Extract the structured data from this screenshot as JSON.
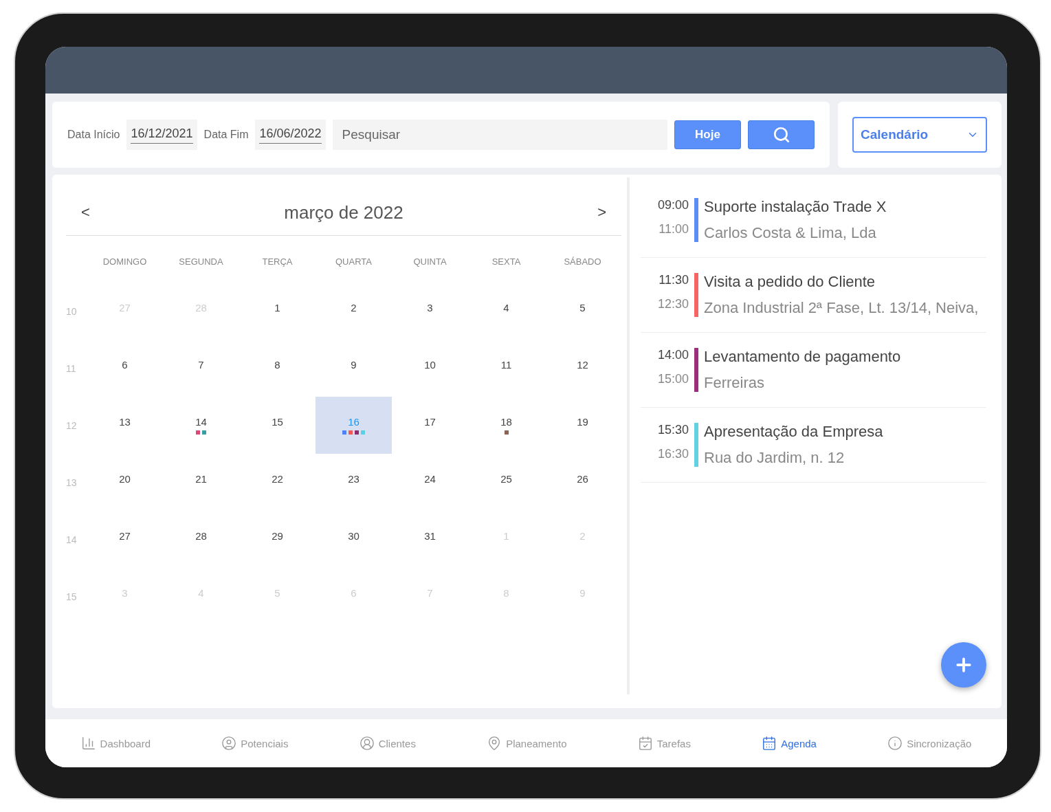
{
  "filters": {
    "start_label": "Data Início",
    "start_value": "16/12/2021",
    "end_label": "Data Fim",
    "end_value": "16/06/2022",
    "search_placeholder": "Pesquisar",
    "today_button": "Hoje",
    "view_select": "Calendário"
  },
  "calendar": {
    "title": "março de 2022",
    "prev": "<",
    "next": ">",
    "weekdays": [
      "DOMINGO",
      "SEGUNDA",
      "TERÇA",
      "QUARTA",
      "QUINTA",
      "SEXTA",
      "SÁBADO"
    ],
    "weeks": [
      {
        "number": "10",
        "days": [
          {
            "label": "27",
            "in_month": false,
            "selected": false
          },
          {
            "label": "28",
            "in_month": false,
            "selected": false
          },
          {
            "label": "1",
            "in_month": true,
            "selected": false
          },
          {
            "label": "2",
            "in_month": true,
            "selected": false
          },
          {
            "label": "3",
            "in_month": true,
            "selected": false
          },
          {
            "label": "4",
            "in_month": true,
            "selected": false
          },
          {
            "label": "5",
            "in_month": true,
            "selected": false
          }
        ]
      },
      {
        "number": "11",
        "days": [
          {
            "label": "6",
            "in_month": true,
            "selected": false
          },
          {
            "label": "7",
            "in_month": true,
            "selected": false
          },
          {
            "label": "8",
            "in_month": true,
            "selected": false
          },
          {
            "label": "9",
            "in_month": true,
            "selected": false
          },
          {
            "label": "10",
            "in_month": true,
            "selected": false
          },
          {
            "label": "11",
            "in_month": true,
            "selected": false
          },
          {
            "label": "12",
            "in_month": true,
            "selected": false
          }
        ]
      },
      {
        "number": "12",
        "days": [
          {
            "label": "13",
            "in_month": true,
            "selected": false
          },
          {
            "label": "14",
            "in_month": true,
            "selected": false,
            "dots": [
              {
                "color": "#d9497a"
              },
              {
                "color": "#3a9ea5"
              }
            ]
          },
          {
            "label": "15",
            "in_month": true,
            "selected": false
          },
          {
            "label": "16",
            "in_month": true,
            "selected": true,
            "dots": [
              {
                "color": "#4f82f7"
              },
              {
                "color": "#f25a5a"
              },
              {
                "color": "#8e2a6e"
              },
              {
                "color": "#5ccfe0"
              }
            ]
          },
          {
            "label": "17",
            "in_month": true,
            "selected": false
          },
          {
            "label": "18",
            "in_month": true,
            "selected": false,
            "dots": [
              {
                "color": "#8a6457"
              }
            ]
          },
          {
            "label": "19",
            "in_month": true,
            "selected": false
          }
        ]
      },
      {
        "number": "13",
        "days": [
          {
            "label": "20",
            "in_month": true,
            "selected": false
          },
          {
            "label": "21",
            "in_month": true,
            "selected": false
          },
          {
            "label": "22",
            "in_month": true,
            "selected": false
          },
          {
            "label": "23",
            "in_month": true,
            "selected": false
          },
          {
            "label": "24",
            "in_month": true,
            "selected": false
          },
          {
            "label": "25",
            "in_month": true,
            "selected": false
          },
          {
            "label": "26",
            "in_month": true,
            "selected": false
          }
        ]
      },
      {
        "number": "14",
        "days": [
          {
            "label": "27",
            "in_month": true,
            "selected": false
          },
          {
            "label": "28",
            "in_month": true,
            "selected": false
          },
          {
            "label": "29",
            "in_month": true,
            "selected": false
          },
          {
            "label": "30",
            "in_month": true,
            "selected": false
          },
          {
            "label": "31",
            "in_month": true,
            "selected": false
          },
          {
            "label": "1",
            "in_month": false,
            "selected": false
          },
          {
            "label": "2",
            "in_month": false,
            "selected": false
          }
        ]
      },
      {
        "number": "15",
        "days": [
          {
            "label": "3",
            "in_month": false,
            "selected": false
          },
          {
            "label": "4",
            "in_month": false,
            "selected": false
          },
          {
            "label": "5",
            "in_month": false,
            "selected": false
          },
          {
            "label": "6",
            "in_month": false,
            "selected": false
          },
          {
            "label": "7",
            "in_month": false,
            "selected": false
          },
          {
            "label": "8",
            "in_month": false,
            "selected": false
          },
          {
            "label": "9",
            "in_month": false,
            "selected": false
          }
        ]
      }
    ]
  },
  "events": [
    {
      "start": "09:00",
      "end": "11:00",
      "title": "Suporte instalação Trade X",
      "subtitle": "Carlos Costa & Lima, Lda",
      "color": "#5b8cf7"
    },
    {
      "start": "11:30",
      "end": "12:30",
      "title": "Visita a pedido do Cliente",
      "subtitle": "Zona Industrial 2ª Fase, Lt. 13/14, Neiva,",
      "color": "#f56565"
    },
    {
      "start": "14:00",
      "end": "15:00",
      "title": "Levantamento de pagamento",
      "subtitle": "Ferreiras",
      "color": "#9b2f7d"
    },
    {
      "start": "15:30",
      "end": "16:30",
      "title": "Apresentação da Empresa",
      "subtitle": "Rua do Jardim, n. 12",
      "color": "#63d1e0"
    }
  ],
  "nav": [
    {
      "label": "Dashboard",
      "selected": false
    },
    {
      "label": "Potenciais",
      "selected": false
    },
    {
      "label": "Clientes",
      "selected": false
    },
    {
      "label": "Planeamento",
      "selected": false
    },
    {
      "label": "Tarefas",
      "selected": false
    },
    {
      "label": "Agenda",
      "selected": true
    },
    {
      "label": "Sincronização",
      "selected": false
    }
  ]
}
